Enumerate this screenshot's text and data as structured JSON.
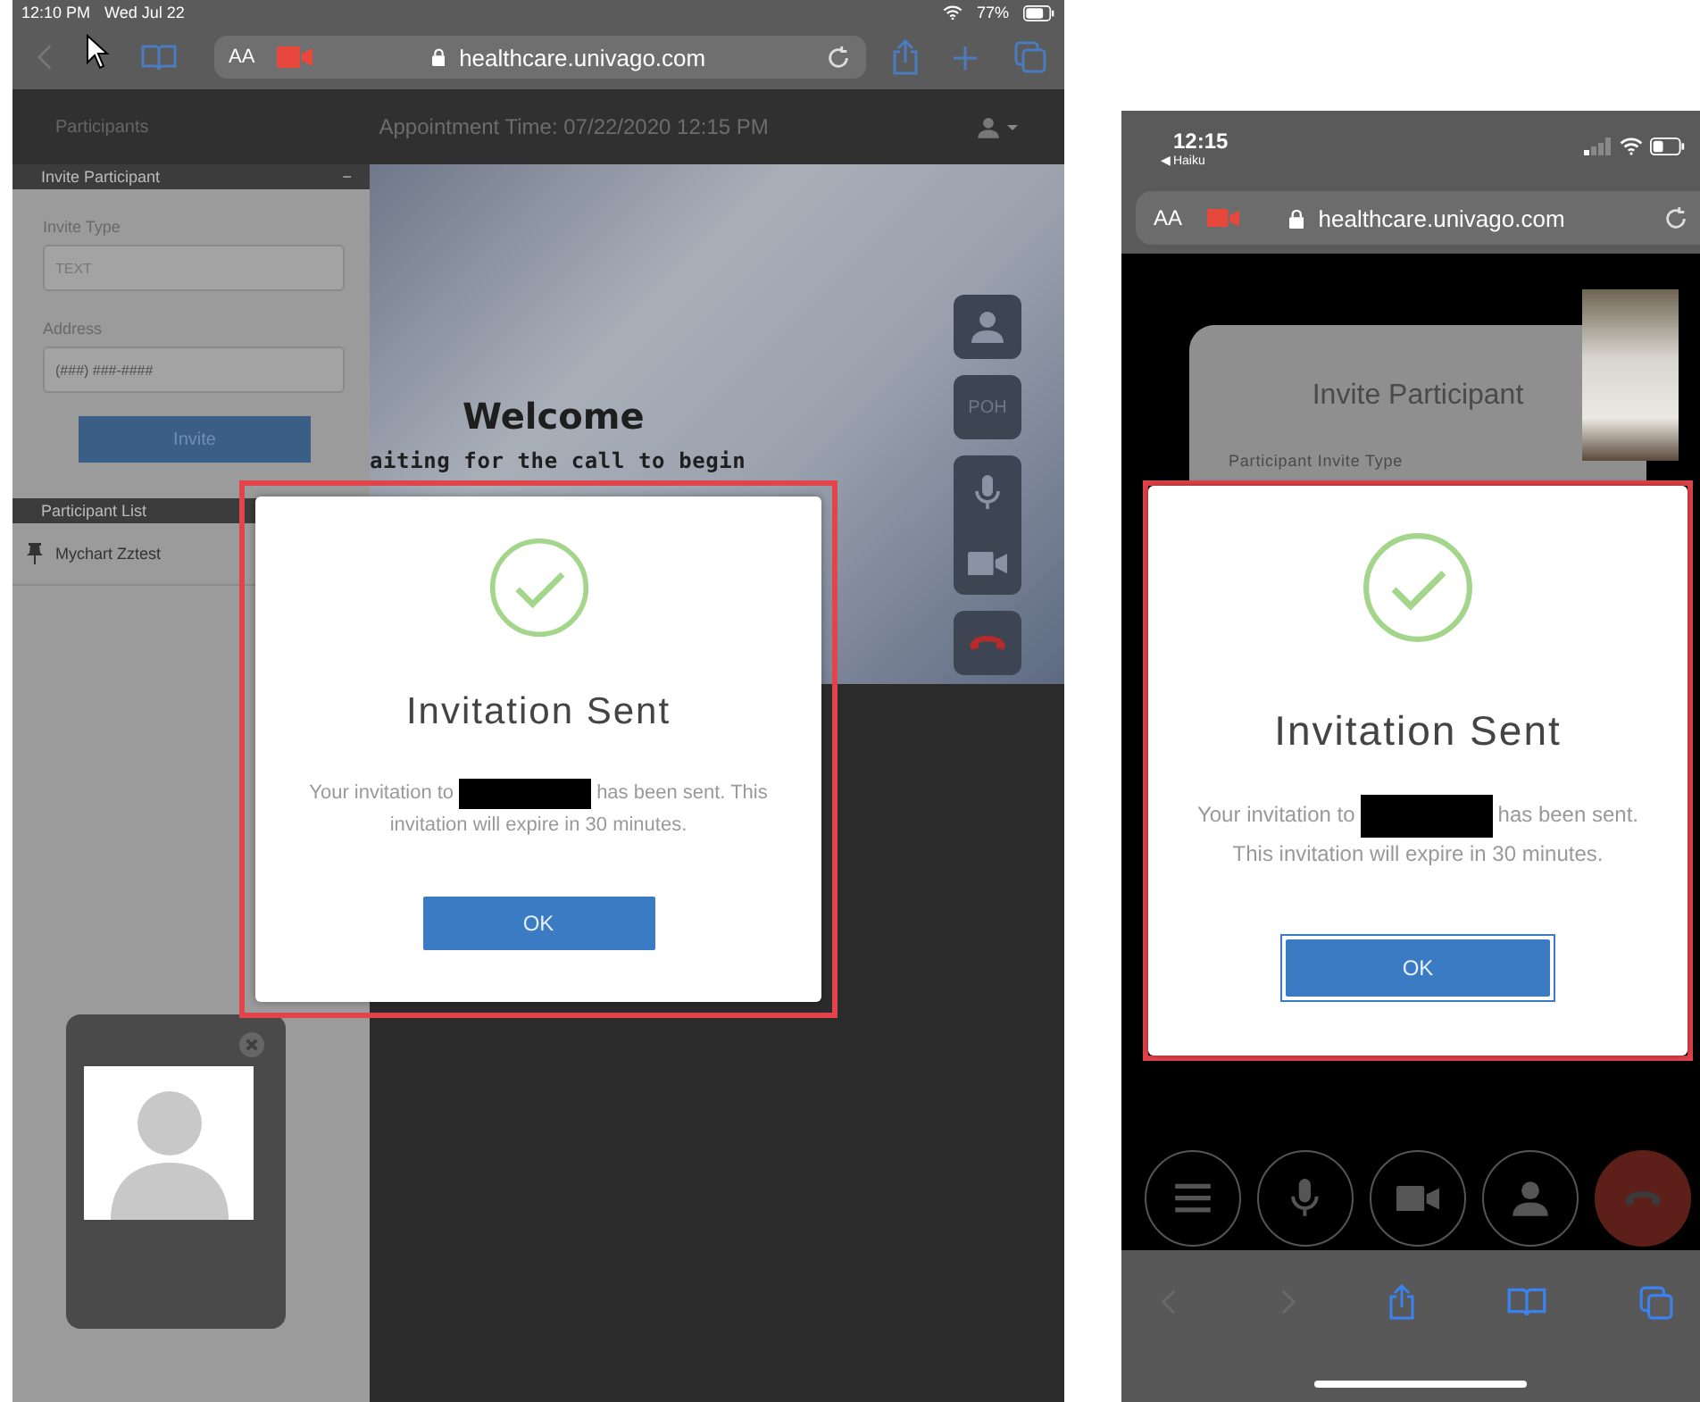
{
  "ipad": {
    "status_bar": {
      "time": "12:10 PM",
      "date": "Wed Jul 22",
      "battery": "77%"
    },
    "browser": {
      "text_size": "AA",
      "url": "healthcare.univago.com"
    },
    "app_header": {
      "participants": "Participants",
      "appointment_time": "Appointment Time: 07/22/2020 12:15 PM"
    },
    "invite_panel": {
      "title": "Invite Participant",
      "collapse": "−",
      "fields": [
        {
          "label": "Invite Type",
          "value": "TEXT"
        },
        {
          "label": "Address",
          "placeholder": "(###) ###-####"
        }
      ],
      "button": "Invite"
    },
    "participant_list": {
      "title": "Participant List",
      "items": [
        {
          "name": "Mychart Zztest"
        }
      ]
    },
    "video": {
      "welcome": "Welcome",
      "waiting": "aiting for the call to begin",
      "poh_button": "POH"
    },
    "dialog": {
      "title": "Invitation Sent",
      "message_lines": [
        [
          {
            "kind": "text",
            "text": "Your invitation to"
          },
          {
            "kind": "redaction"
          },
          {
            "kind": "text",
            "text": "has been sent. This"
          }
        ],
        [
          {
            "kind": "text",
            "text": "invitation will expire in 30 minutes."
          }
        ]
      ],
      "button": "OK"
    }
  },
  "iphone": {
    "status_bar": {
      "time": "12:15",
      "back_app": "◀ Haiku"
    },
    "browser": {
      "text_size": "AA",
      "url": "healthcare.univago.com"
    },
    "invite_card": {
      "title": "Invite Participant",
      "field_label": "Participant Invite Type"
    },
    "dialog": {
      "title": "Invitation Sent",
      "message_lines": [
        [
          {
            "kind": "text",
            "text": "Your invitation to"
          },
          {
            "kind": "redaction"
          },
          {
            "kind": "text",
            "text": "has been sent."
          }
        ],
        [
          {
            "kind": "text",
            "text": "This invitation will expire in 30 minutes."
          }
        ]
      ],
      "button": "OK",
      "focused": true
    }
  }
}
